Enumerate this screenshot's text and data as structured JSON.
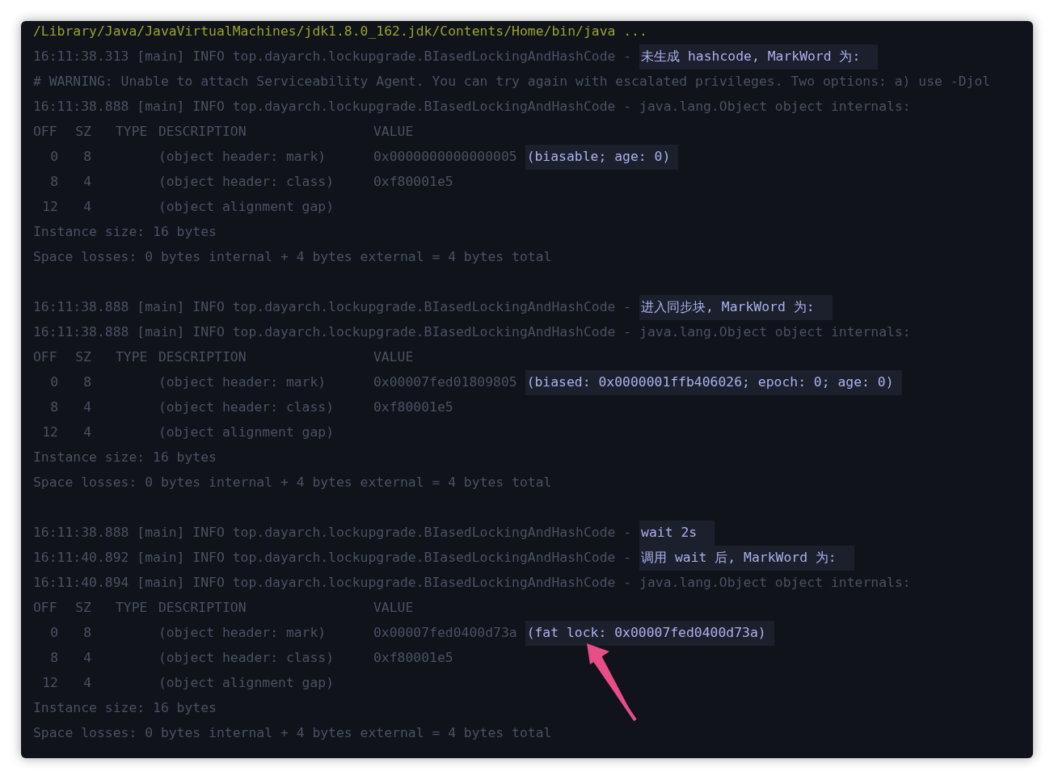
{
  "terminal": {
    "lines": [
      {
        "kind": "path",
        "text": "/Library/Java/JavaVirtualMachines/jdk1.8.0_162.jdk/Contents/Home/bin/java ..."
      },
      {
        "kind": "log",
        "prefix": "16:11:38.313 [main] INFO top.dayarch.lockupgrade.BIasedLockingAndHashCode -",
        "message": "未生成 hashcode, MarkWord 为:",
        "highlighted": true
      },
      {
        "kind": "warning",
        "text": "# WARNING: Unable to attach Serviceability Agent. You can try again with escalated privileges. Two options: a) use -Djol"
      },
      {
        "kind": "log",
        "prefix": "16:11:38.888 [main] INFO top.dayarch.lockupgrade.BIasedLockingAndHashCode -",
        "message": "java.lang.Object object internals:",
        "highlighted": false
      },
      {
        "kind": "table_header",
        "off": "OFF",
        "sz": "SZ",
        "type": "TYPE",
        "description": "DESCRIPTION",
        "value": "VALUE"
      },
      {
        "kind": "table_row",
        "off": "0",
        "sz": "8",
        "description": "(object header: mark)",
        "value": "0x0000000000000005",
        "note": "(biasable; age: 0)"
      },
      {
        "kind": "table_row",
        "off": "8",
        "sz": "4",
        "description": "(object header: class)",
        "value": "0xf80001e5"
      },
      {
        "kind": "table_row",
        "off": "12",
        "sz": "4",
        "description": "(object alignment gap)"
      },
      {
        "kind": "summary",
        "text": "Instance size: 16 bytes"
      },
      {
        "kind": "summary",
        "text": "Space losses: 0 bytes internal + 4 bytes external = 4 bytes total"
      },
      {
        "kind": "blank"
      },
      {
        "kind": "log",
        "prefix": "16:11:38.888 [main] INFO top.dayarch.lockupgrade.BIasedLockingAndHashCode -",
        "message": "进入同步块, MarkWord 为:",
        "highlighted": true
      },
      {
        "kind": "log",
        "prefix": "16:11:38.888 [main] INFO top.dayarch.lockupgrade.BIasedLockingAndHashCode -",
        "message": "java.lang.Object object internals:",
        "highlighted": false
      },
      {
        "kind": "table_header",
        "off": "OFF",
        "sz": "SZ",
        "type": "TYPE",
        "description": "DESCRIPTION",
        "value": "VALUE"
      },
      {
        "kind": "table_row",
        "off": "0",
        "sz": "8",
        "description": "(object header: mark)",
        "value": "0x00007fed01809805",
        "note": "(biased: 0x0000001ffb406026; epoch: 0; age: 0)"
      },
      {
        "kind": "table_row",
        "off": "8",
        "sz": "4",
        "description": "(object header: class)",
        "value": "0xf80001e5"
      },
      {
        "kind": "table_row",
        "off": "12",
        "sz": "4",
        "description": "(object alignment gap)"
      },
      {
        "kind": "summary",
        "text": "Instance size: 16 bytes"
      },
      {
        "kind": "summary",
        "text": "Space losses: 0 bytes internal + 4 bytes external = 4 bytes total"
      },
      {
        "kind": "blank"
      },
      {
        "kind": "log",
        "prefix": "16:11:38.888 [main] INFO top.dayarch.lockupgrade.BIasedLockingAndHashCode -",
        "message": "wait 2s",
        "highlighted": true
      },
      {
        "kind": "log",
        "prefix": "16:11:40.892 [main] INFO top.dayarch.lockupgrade.BIasedLockingAndHashCode -",
        "message": "调用 wait 后, MarkWord 为:",
        "highlighted": true
      },
      {
        "kind": "log",
        "prefix": "16:11:40.894 [main] INFO top.dayarch.lockupgrade.BIasedLockingAndHashCode -",
        "message": "java.lang.Object object internals:",
        "highlighted": false
      },
      {
        "kind": "table_header",
        "off": "OFF",
        "sz": "SZ",
        "type": "TYPE",
        "description": "DESCRIPTION",
        "value": "VALUE"
      },
      {
        "kind": "table_row",
        "off": "0",
        "sz": "8",
        "description": "(object header: mark)",
        "value": "0x00007fed0400d73a",
        "note": "(fat lock: 0x00007fed0400d73a)"
      },
      {
        "kind": "table_row",
        "off": "8",
        "sz": "4",
        "description": "(object header: class)",
        "value": "0xf80001e5"
      },
      {
        "kind": "table_row",
        "off": "12",
        "sz": "4",
        "description": "(object alignment gap)"
      },
      {
        "kind": "summary",
        "text": "Instance size: 16 bytes"
      },
      {
        "kind": "summary",
        "text": "Space losses: 0 bytes internal + 4 bytes external = 4 bytes total"
      }
    ]
  }
}
